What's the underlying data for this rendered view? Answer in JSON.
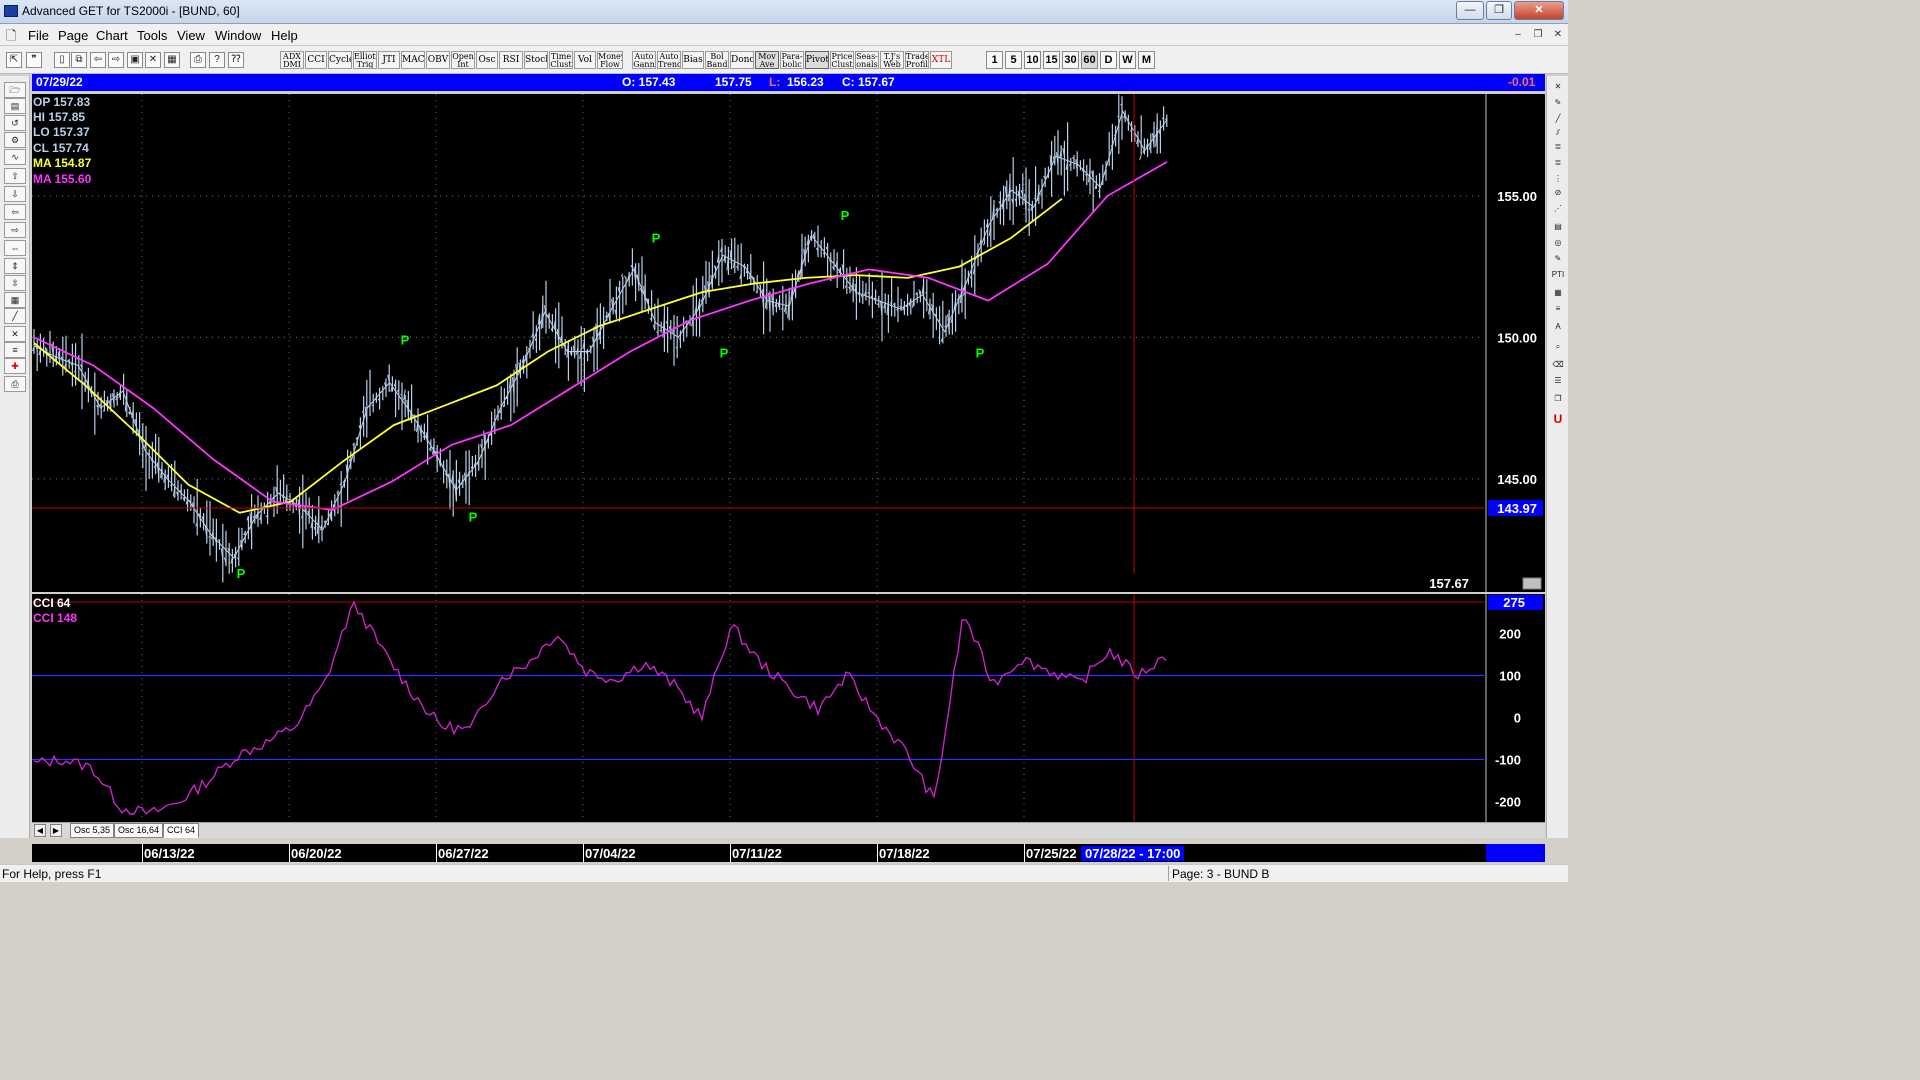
{
  "window": {
    "title": "Advanced GET for TS2000i - [BUND, 60]",
    "minimize": "—",
    "maximize": "❐",
    "close": "✕"
  },
  "menu": [
    "File",
    "Page",
    "Chart",
    "Tools",
    "View",
    "Window",
    "Help"
  ],
  "toolbar": {
    "studies": [
      [
        "ADX",
        "DMI"
      ],
      [
        "CCI"
      ],
      [
        "Cycles"
      ],
      [
        "Elliott",
        "Trig"
      ],
      [
        "JTI"
      ],
      [
        "MACD"
      ],
      [
        "OBV"
      ],
      [
        "Open",
        "Int"
      ],
      [
        "Osc"
      ],
      [
        "RSI"
      ],
      [
        "Stoch"
      ],
      [
        "Time",
        "Clust"
      ],
      [
        "Vol"
      ],
      [
        "Money",
        "Flow"
      ],
      [
        "Auto",
        "Gann"
      ],
      [
        "Auto",
        "Trend"
      ],
      [
        "Bias"
      ],
      [
        "Bol",
        "Band"
      ],
      [
        "Donch"
      ],
      [
        "Mov",
        "Ave"
      ],
      [
        "Para-",
        "bolic"
      ],
      [
        "Pivot"
      ],
      [
        "Price",
        "Clust"
      ],
      [
        "Seas-",
        "onals"
      ],
      [
        "T.J's",
        "Web"
      ],
      [
        "Trade",
        "Profile"
      ],
      [
        "XTL"
      ]
    ],
    "periods": [
      "1",
      "5",
      "10",
      "15",
      "30",
      "60",
      "D",
      "W",
      "M"
    ],
    "active_period": "60"
  },
  "chart_header": {
    "date": "07/29/22",
    "open": "O: 157.43",
    "high": "157.75",
    "low_prefix": "L:",
    "low": "156.23",
    "close": "C: 157.67",
    "change": "-0.01"
  },
  "legend": {
    "op": "OP  157.83",
    "hi": "HI   157.85",
    "lo": "LO  157.37",
    "cl": "CL  157.74",
    "ma1": "MA  154.87",
    "ma2": "MA  155.60"
  },
  "price_axis": {
    "ticks": [
      "155.00",
      "150.00",
      "145.00"
    ],
    "cursor_price": "143.97",
    "last_price": "157.67"
  },
  "cci_pane": {
    "title": "CCI 64",
    "value": "CCI  148",
    "top_value": "275",
    "ticks": [
      "200",
      "100",
      "0",
      "-100",
      "-200"
    ]
  },
  "tabs": [
    "Osc 5,35",
    "Osc 16,64",
    "CCI 64"
  ],
  "active_tab": "CCI 64",
  "date_axis": {
    "labels": [
      "06/13/22",
      "06/20/22",
      "06/27/22",
      "07/04/22",
      "07/11/22",
      "07/18/22",
      "07/25/22"
    ],
    "cursor_label": "07/28/22 - 17:00"
  },
  "status": {
    "help": "For Help, press F1",
    "page": "Page: 3 - BUND B"
  },
  "colors": {
    "background": "#000000",
    "bars": "#b8cfe8",
    "ma_fast": "#ffff33",
    "ma_slow": "#ff33ff",
    "pivot_marker": "#00ff00",
    "cursor_line": "#c00000",
    "cci": "#cc22cc",
    "header_blue": "#0000ff"
  },
  "chart_data": {
    "type": "line",
    "title": "BUND, 60",
    "y_unit": "price",
    "ylim": [
      141.0,
      158.6
    ],
    "series": [
      {
        "name": "",
        "kind": "price-approx",
        "values": [
          149.7,
          149.3,
          149.0,
          147.5,
          148.1,
          146.0,
          145.0,
          144.2,
          143.0,
          142.2,
          143.7,
          144.5,
          144.0,
          143.2,
          144.9,
          147.5,
          148.4,
          147.3,
          146.0,
          144.6,
          145.6,
          147.5,
          149.0,
          150.9,
          149.5,
          149.5,
          151.0,
          152.4,
          150.5,
          150.0,
          151.1,
          152.9,
          152.5,
          151.3,
          151.1,
          153.6,
          152.6,
          151.6,
          151.3,
          151.0,
          151.5,
          150.2,
          152.0,
          154.0,
          155.2,
          154.6,
          156.4,
          156.1,
          155.3,
          158.0,
          156.6,
          157.7
        ]
      },
      {
        "name": "MA",
        "values": [
          149.8,
          148.3,
          146.6,
          144.8,
          143.8,
          144.2,
          145.6,
          146.9,
          147.6,
          148.3,
          149.5,
          150.4,
          151.0,
          151.6,
          151.9,
          152.1,
          152.2,
          152.1,
          152.5,
          153.5,
          154.9
        ]
      },
      {
        "name": "MA",
        "values": [
          150.0,
          149.0,
          147.5,
          145.7,
          144.2,
          143.9,
          144.9,
          146.2,
          146.9,
          148.2,
          149.5,
          150.6,
          151.3,
          151.9,
          152.4,
          152.1,
          151.3,
          152.6,
          155.0,
          156.2
        ]
      },
      {
        "name": "CCI 64",
        "values": [
          -110,
          -100,
          -120,
          -215,
          -230,
          -200,
          -150,
          -90,
          -60,
          -20,
          80,
          275,
          160,
          60,
          -20,
          -30,
          90,
          130,
          200,
          110,
          90,
          130,
          80,
          0,
          220,
          130,
          70,
          20,
          100,
          0,
          -80,
          -200,
          250,
          80,
          140,
          110,
          80,
          160,
          100,
          148
        ]
      }
    ],
    "cci_ylim": [
      -230,
      275
    ],
    "cci_reference_lines": [
      100,
      -100
    ],
    "pivots": [
      {
        "label": "P",
        "price": 142.2,
        "date": "06/14/22"
      },
      {
        "label": "P",
        "price": 149.4,
        "date": "06/23/22"
      },
      {
        "label": "P",
        "price": 144.2,
        "date": "06/28/22"
      },
      {
        "label": "P",
        "price": 153.0,
        "date": "07/06/22"
      },
      {
        "label": "P",
        "price": 150.0,
        "date": "07/11/22"
      },
      {
        "label": "P",
        "price": 153.8,
        "date": "07/14/22"
      },
      {
        "label": "P",
        "price": 150.0,
        "date": "07/22/22"
      }
    ],
    "cursor_date": "07/28/22 - 17:00",
    "cursor_price": 143.97
  }
}
